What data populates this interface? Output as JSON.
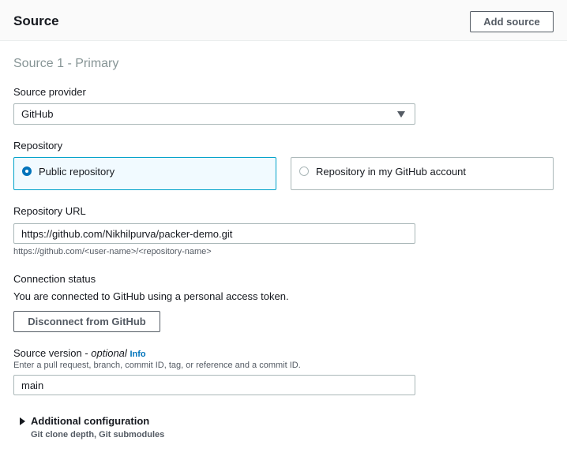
{
  "header": {
    "title": "Source",
    "add_source_label": "Add source"
  },
  "section": {
    "heading": "Source 1 - Primary"
  },
  "source_provider": {
    "label": "Source provider",
    "selected": "GitHub",
    "caret_icon": "caret-down-icon"
  },
  "repository": {
    "label": "Repository",
    "options": [
      {
        "label": "Public repository",
        "selected": true
      },
      {
        "label": "Repository in my GitHub account",
        "selected": false
      }
    ]
  },
  "repository_url": {
    "label": "Repository URL",
    "value": "https://github.com/Nikhilpurva/packer-demo.git",
    "hint": "https://github.com/<user-name>/<repository-name>"
  },
  "connection": {
    "label": "Connection status",
    "status_text": "You are connected to GitHub using a personal access token.",
    "disconnect_label": "Disconnect from GitHub"
  },
  "source_version": {
    "label": "Source version - ",
    "optional": "optional",
    "info": "Info",
    "hint": "Enter a pull request, branch, commit ID, tag, or reference and a commit ID.",
    "value": "main"
  },
  "additional_config": {
    "label": "Additional configuration",
    "sublabel": "Git clone depth, Git submodules",
    "caret_icon": "caret-right-icon"
  },
  "colors": {
    "accent": "#0073bb",
    "selected_tile_bg": "#f1faff",
    "selected_tile_border": "#00a1c9",
    "text": "#16191f",
    "muted": "#879596"
  }
}
